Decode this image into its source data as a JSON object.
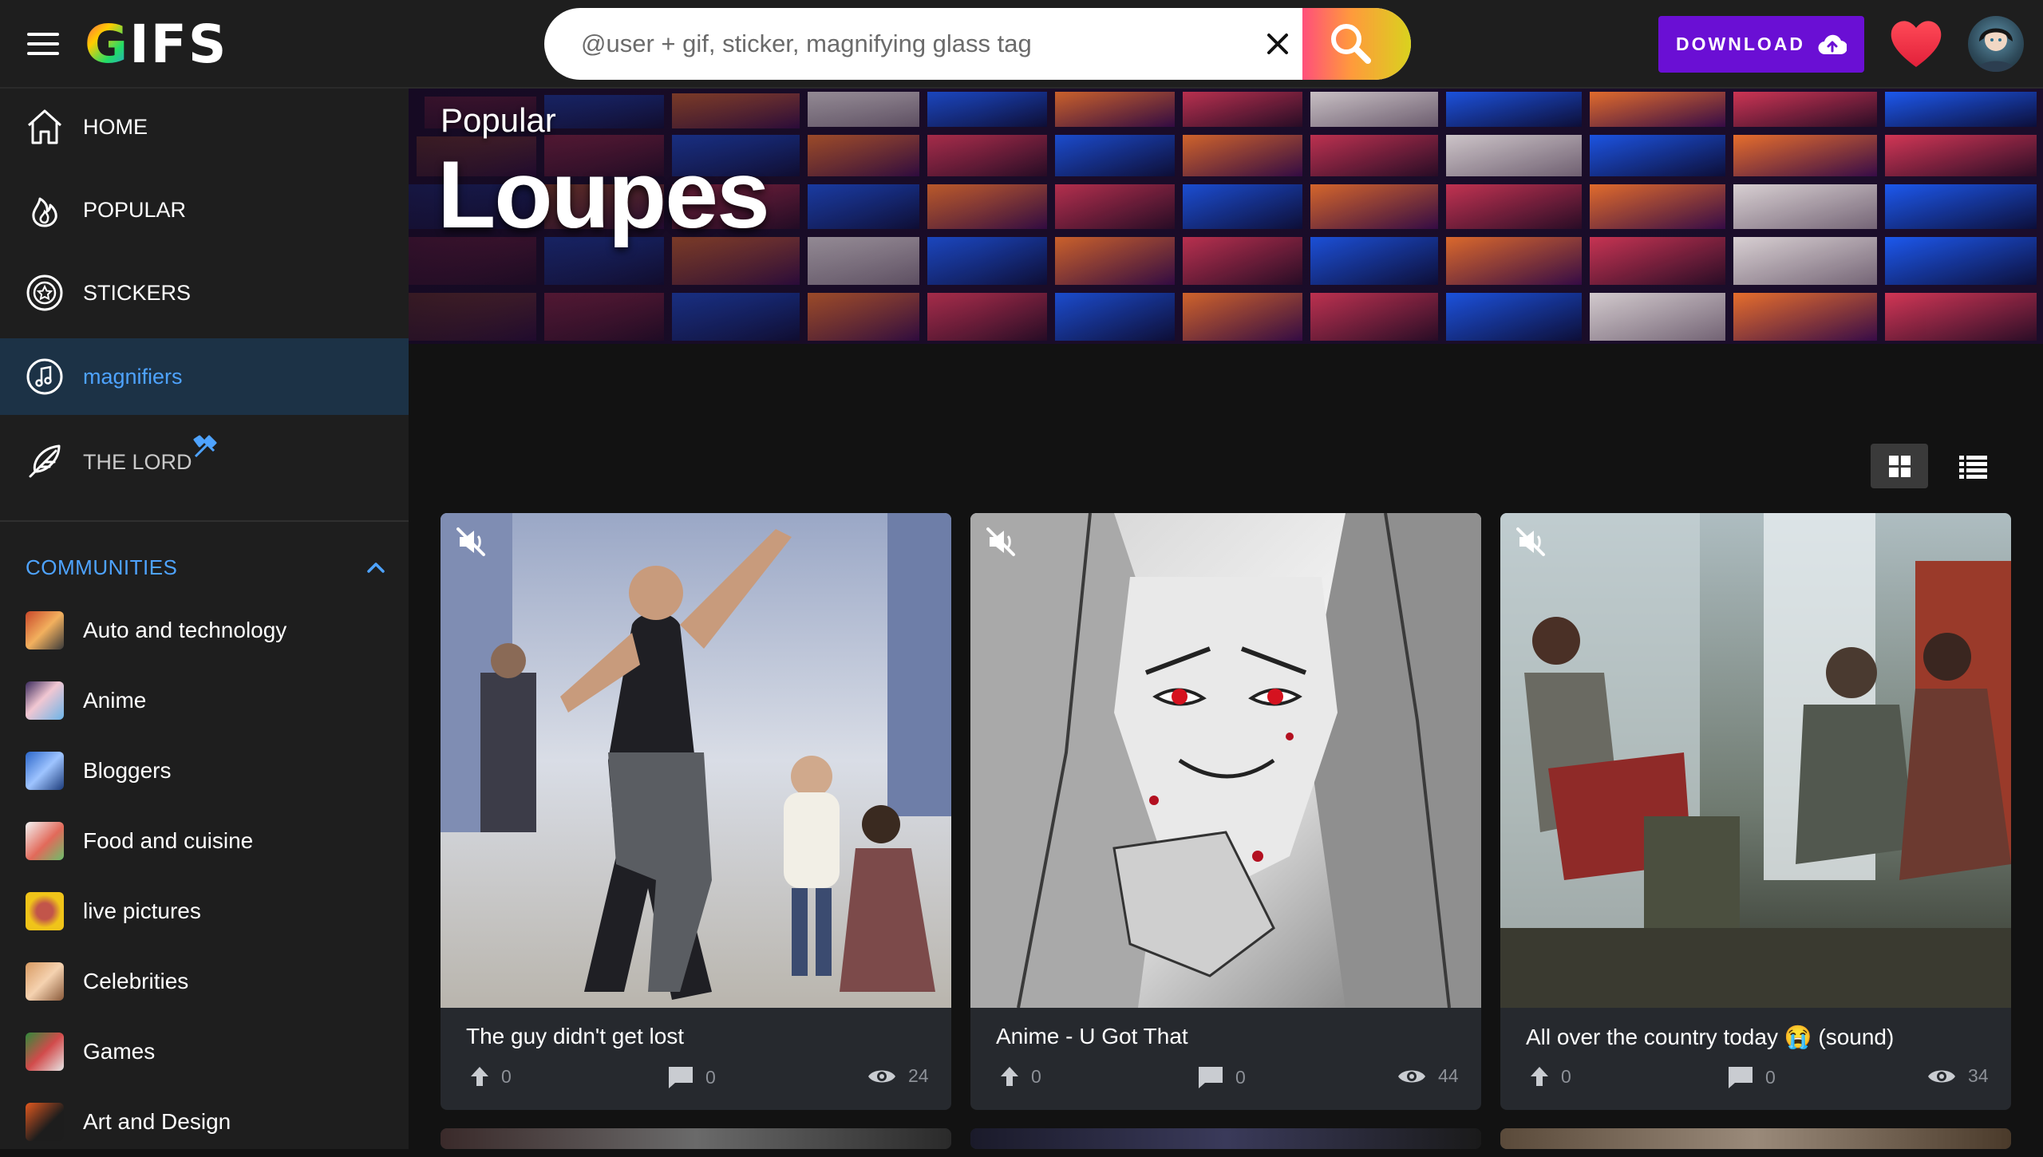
{
  "header": {
    "logo": "GIFS",
    "search_placeholder": "@user + gif, sticker, magnifying glass tag",
    "download_label": "DOWNLOAD"
  },
  "sidebar": {
    "nav": [
      {
        "label": "HOME",
        "icon": "home-icon"
      },
      {
        "label": "POPULAR",
        "icon": "flame-icon"
      },
      {
        "label": "STICKERS",
        "icon": "sticker-icon"
      },
      {
        "label": "magnifiers",
        "icon": "music-note-icon",
        "active": true
      },
      {
        "label": "THE LORD",
        "icon": "feather-icon",
        "badge_icon": "tools-icon"
      }
    ],
    "communities_label": "COMMUNITIES",
    "communities": [
      {
        "label": "Auto and technology"
      },
      {
        "label": "Anime"
      },
      {
        "label": "Bloggers"
      },
      {
        "label": "Food and cuisine"
      },
      {
        "label": "live pictures"
      },
      {
        "label": "Celebrities"
      },
      {
        "label": "Games"
      },
      {
        "label": "Art and Design"
      }
    ]
  },
  "banner": {
    "subtitle": "Popular",
    "title": "Loupes"
  },
  "cards": [
    {
      "title": "The guy didn't get lost",
      "upvotes": "0",
      "comments": "0",
      "views": "24"
    },
    {
      "title": "Anime - U Got That",
      "upvotes": "0",
      "comments": "0",
      "views": "44"
    },
    {
      "title": "All over the country today 😭 (sound)",
      "upvotes": "0",
      "comments": "0",
      "views": "34"
    }
  ],
  "colors": {
    "accent": "#4ea3ff",
    "download": "#6a0fd4",
    "card_bg": "#26292e",
    "sidebar_bg": "#1e1e1e"
  }
}
